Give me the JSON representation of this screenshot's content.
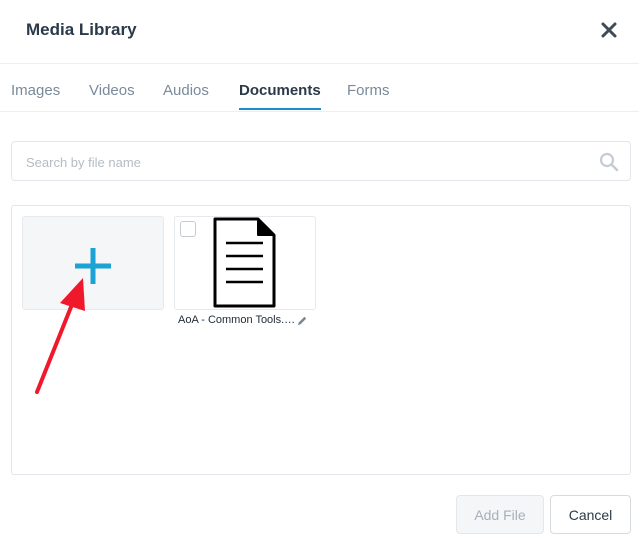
{
  "modal": {
    "title": "Media Library",
    "close_icon": "close-icon"
  },
  "tabs": [
    {
      "label": "Images",
      "active": false
    },
    {
      "label": "Videos",
      "active": false
    },
    {
      "label": "Audios",
      "active": false
    },
    {
      "label": "Documents",
      "active": true
    },
    {
      "label": "Forms",
      "active": false
    }
  ],
  "search": {
    "placeholder": "Search by file name",
    "value": "",
    "icon": "search-icon"
  },
  "library": {
    "add_tile_icon": "plus-icon",
    "files": [
      {
        "name": "AoA - Common Tools.…",
        "icon": "document-icon",
        "checked": false,
        "edit_icon": "pencil-icon"
      }
    ]
  },
  "annotation": {
    "icon": "arrow-icon",
    "color": "#f0192b"
  },
  "footer": {
    "add_file_label": "Add File",
    "cancel_label": "Cancel"
  },
  "colors": {
    "accent": "#1a8ec9",
    "plus": "#1aa3d4",
    "text": "#2b3a4a",
    "muted": "#7a8a9b"
  }
}
